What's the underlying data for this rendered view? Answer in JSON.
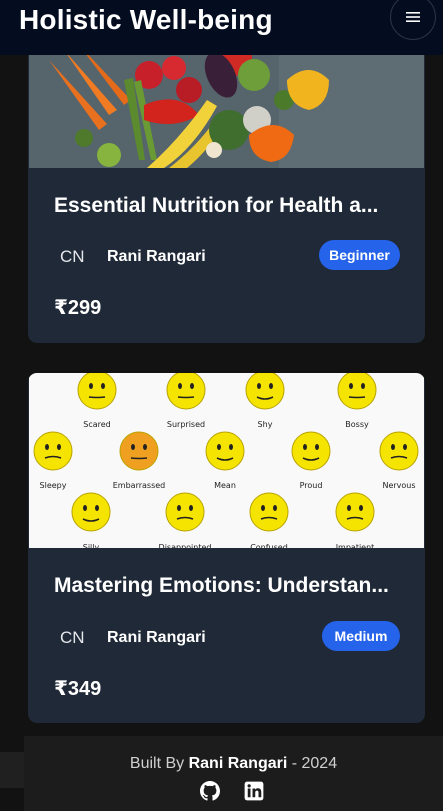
{
  "header": {
    "title": "Holistic Well-being",
    "menu_icon": "hamburger-menu-icon"
  },
  "courses": [
    {
      "title": "Essential Nutrition for Health a...",
      "avatar": "CN",
      "author": "Rani Rangari",
      "level": "Beginner",
      "price": "₹299",
      "image": "vegetables"
    },
    {
      "title": "Mastering Emotions: Understan...",
      "avatar": "CN",
      "author": "Rani Rangari",
      "level": "Medium",
      "price": "₹349",
      "image": "emotion-faces",
      "image_labels": [
        "Scared",
        "Surprised",
        "Shy",
        "Bossy",
        "Sleepy",
        "Embarrassed",
        "Mean",
        "Proud",
        "Nervous",
        "Silly",
        "Disappointed",
        "Confused",
        "Impatient"
      ]
    }
  ],
  "footer": {
    "prefix": "Built By",
    "name": "Rani Rangari",
    "suffix": "- 2024",
    "icons": [
      "github-icon",
      "linkedin-icon"
    ]
  },
  "colors": {
    "header_bg": "#030d1f",
    "card_bg": "#1f2937",
    "badge_bg": "#2563eb",
    "page_bg": "#121212"
  }
}
